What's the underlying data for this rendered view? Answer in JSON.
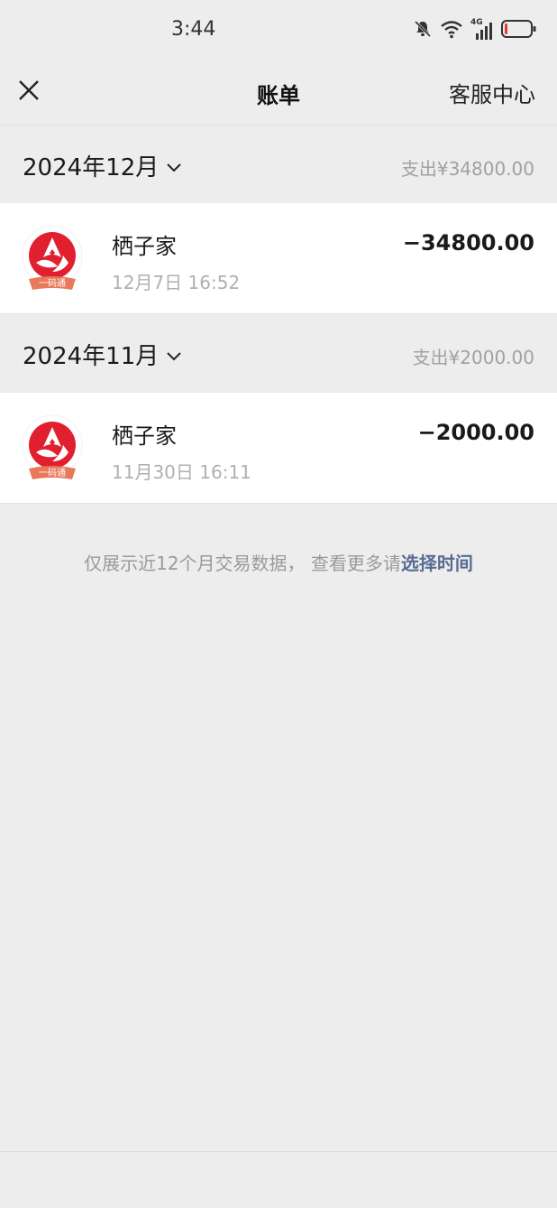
{
  "status_bar": {
    "time": "3:44",
    "network": "4G",
    "icons": [
      "mute-bell-icon",
      "wifi-icon",
      "signal-icon",
      "battery-icon"
    ],
    "battery_color": "#e53935"
  },
  "nav": {
    "close_icon": "close-icon",
    "title": "账单",
    "right_label": "客服中心"
  },
  "months": [
    {
      "label": "2024年12月",
      "summary": "支出¥34800.00",
      "transactions": [
        {
          "name": "栖子家",
          "time": "12月7日 16:52",
          "amount": "−34800.00",
          "logo_text": "一码通"
        }
      ]
    },
    {
      "label": "2024年11月",
      "summary": "支出¥2000.00",
      "transactions": [
        {
          "name": "栖子家",
          "time": "11月30日 16:11",
          "amount": "−2000.00",
          "logo_text": "一码通"
        }
      ]
    }
  ],
  "footer": {
    "note": "仅展示近12个月交易数据， 查看更多请",
    "link": "选择时间"
  },
  "colors": {
    "background": "#ededed",
    "link": "#576b95",
    "logo_red": "#e0202f",
    "logo_ribbon": "#e8795a"
  }
}
